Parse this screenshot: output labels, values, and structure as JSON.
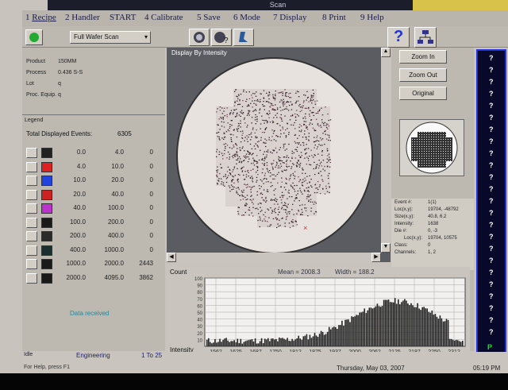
{
  "window": {
    "title": "Scan"
  },
  "menu": [
    {
      "key": "1",
      "label": "Recipe"
    },
    {
      "key": "2",
      "label": "Handler"
    },
    {
      "key": "",
      "label": "START"
    },
    {
      "key": "4",
      "label": "Calibrate"
    },
    {
      "key": "5",
      "label": "Save"
    },
    {
      "key": "6",
      "label": "Mode"
    },
    {
      "key": "7",
      "label": "Display"
    },
    {
      "key": "8",
      "label": "Print"
    },
    {
      "key": "9",
      "label": "Help"
    }
  ],
  "toolbar": {
    "scan_mode": "Full Wafer Scan"
  },
  "info": [
    {
      "label": "Product",
      "value": "150MM"
    },
    {
      "label": "Process",
      "value": "0.436 S-S"
    },
    {
      "label": "Lot",
      "value": "q"
    },
    {
      "label": "Proc. Equip.",
      "value": "q"
    }
  ],
  "legend": {
    "title": "Legend",
    "total_label": "Total Displayed Events:",
    "total_value": "6305",
    "rows": [
      {
        "color": "#222222",
        "min": "0.0",
        "max": "4.0",
        "count": "0"
      },
      {
        "color": "#dd2222",
        "min": "4.0",
        "max": "10.0",
        "count": "0"
      },
      {
        "color": "#2244dd",
        "min": "10.0",
        "max": "20.0",
        "count": "0"
      },
      {
        "color": "#cc2222",
        "min": "20.0",
        "max": "40.0",
        "count": "0"
      },
      {
        "color": "#bb33cc",
        "min": "40.0",
        "max": "100.0",
        "count": "0"
      },
      {
        "color": "#1a1a1a",
        "min": "100.0",
        "max": "200.0",
        "count": "0"
      },
      {
        "color": "#2a2a2a",
        "min": "200.0",
        "max": "400.0",
        "count": "0"
      },
      {
        "color": "#1a3030",
        "min": "400.0",
        "max": "1000.0",
        "count": "0"
      },
      {
        "color": "#1a1a1a",
        "min": "1000.0",
        "max": "2000.0",
        "count": "2443"
      },
      {
        "color": "#1a1a1a",
        "min": "2000.0",
        "max": "4095.0",
        "count": "3862"
      }
    ]
  },
  "wafer_view": {
    "title": "Display By Intensity"
  },
  "zoom": {
    "in": "Zoom In",
    "out": "Zoom Out",
    "original": "Original"
  },
  "event": [
    {
      "label": "Event #:",
      "value": "1(1)"
    },
    {
      "label": "Loc(x,y):",
      "value": "19704, -48792"
    },
    {
      "label": "Size(x,y):",
      "value": "40.8, 6.2"
    },
    {
      "label": "Intensity:",
      "value": "1638"
    },
    {
      "label": "Die #:",
      "value": "0, -3"
    },
    {
      "label": "Loc(x,y):",
      "value": "19704, 10575"
    },
    {
      "label": "Class:",
      "value": "0"
    },
    {
      "label": "Channels:",
      "value": "1, 2"
    }
  ],
  "histogram": {
    "count_label": "Count",
    "mean": "Mean = 2008.3",
    "width": "Width = 188.2",
    "intensity_label": "Intensity",
    "y_ticks": [
      "100",
      "90",
      "80",
      "70",
      "60",
      "50",
      "40",
      "30",
      "20",
      "10"
    ],
    "x_ticks": [
      "1562",
      "1625",
      "1687",
      "1750",
      "1812",
      "1875",
      "1937",
      "2000",
      "2062",
      "2125",
      "2187",
      "2250",
      "2312"
    ]
  },
  "status": {
    "mode_label": "Idle",
    "user": "Engineering",
    "range": "1 To 25",
    "message": "Data received",
    "help": "For Help, press F1",
    "date": "Thursday, May 03, 2007",
    "time": "05:19 PM"
  },
  "qcolumn": [
    "?",
    "?",
    "?",
    "?",
    "?",
    "?",
    "?",
    "?",
    "?",
    "?",
    "?",
    "?",
    "?",
    "?",
    "?",
    "?",
    "?",
    "?",
    "?",
    "?",
    "?",
    "?",
    "?",
    "?"
  ],
  "colors": {
    "accent_blue": "#2233dd",
    "menu_text": "#1b1b4a"
  }
}
